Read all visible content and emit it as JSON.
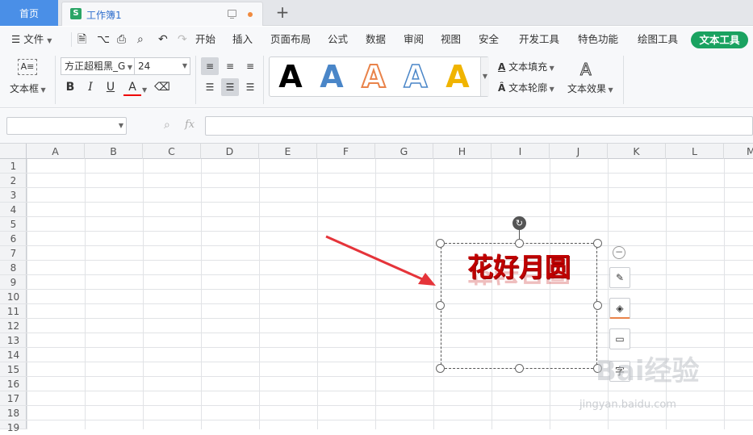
{
  "tabs": {
    "home": "首页",
    "workbook": "工作簿1",
    "new_tab": "+"
  },
  "menu": {
    "file": "文件",
    "items": [
      "开始",
      "插入",
      "页面布局",
      "公式",
      "数据",
      "审阅",
      "视图",
      "安全",
      "开发工具",
      "特色功能",
      "绘图工具"
    ],
    "active": "文本工具"
  },
  "ribbon": {
    "textbox_label": "文本框",
    "font_name": "方正超粗黑_G",
    "font_size": "24",
    "art_letter": "A",
    "art_colors": [
      "#000000",
      "#4a86c8",
      "#e9834a",
      "#4a86c8",
      "#f0b400"
    ],
    "fill_label": "文本填充",
    "outline_label": "文本轮廓",
    "effect_label": "文本效果"
  },
  "formula": {
    "fx": "fx"
  },
  "columns": [
    "A",
    "B",
    "C",
    "D",
    "E",
    "F",
    "G",
    "H",
    "I",
    "J",
    "K",
    "L",
    "M"
  ],
  "rows": [
    "1",
    "2",
    "3",
    "4",
    "5",
    "6",
    "7",
    "8",
    "9",
    "10",
    "11",
    "12",
    "13",
    "14",
    "15",
    "16",
    "17",
    "18",
    "19"
  ],
  "textbox": {
    "art_text": "花好月圆"
  },
  "watermark": {
    "logo": "Bai经验",
    "url": "jingyan.baidu.com"
  },
  "colors": {
    "accent": "#4a8fe7",
    "active_tab": "#1aa260",
    "art_text": "#c00000",
    "arrow": "#e5343a"
  }
}
